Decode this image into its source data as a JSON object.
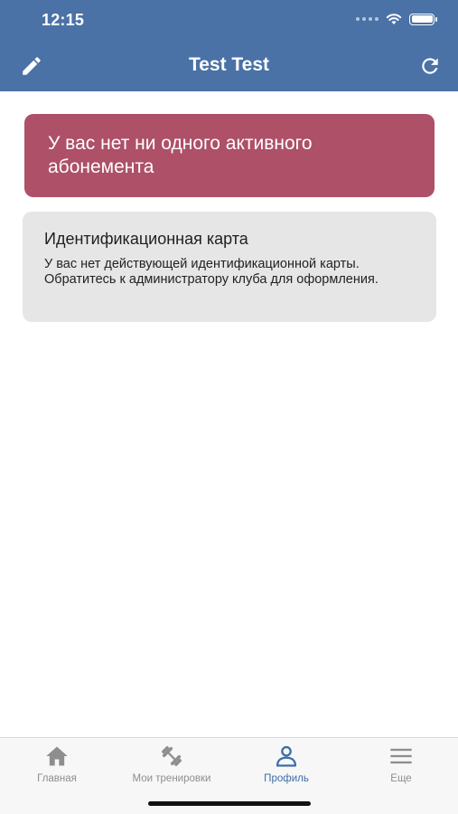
{
  "status_bar": {
    "time": "12:15"
  },
  "nav": {
    "title": "Test Test",
    "left_icon": "pencil-icon",
    "right_icon": "refresh-icon"
  },
  "alert_card": {
    "text": "У вас нет ни одного активного абонемента"
  },
  "id_card": {
    "title": "Идентификационная карта",
    "text": "У вас нет действующей идентификационной карты. Обратитесь к администратору клуба для оформления."
  },
  "tabbar": {
    "tabs": [
      {
        "label": "Главная",
        "icon": "home-icon",
        "active": false
      },
      {
        "label": "Мои тренировки",
        "icon": "dumbbell-icon",
        "active": false
      },
      {
        "label": "Профиль",
        "icon": "person-icon",
        "active": true
      },
      {
        "label": "Еще",
        "icon": "menu-icon",
        "active": false
      }
    ]
  },
  "colors": {
    "header": "#4a72a6",
    "alert": "#ad5068",
    "card": "#e6e6e6",
    "tab_active": "#3f6ea8",
    "tab_inactive": "#8e8e8e"
  }
}
